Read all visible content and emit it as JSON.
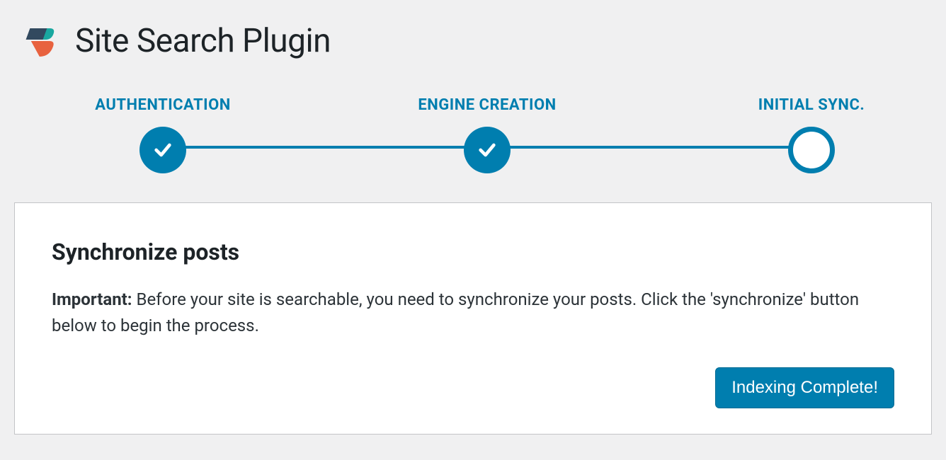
{
  "header": {
    "title": "Site Search Plugin"
  },
  "stepper": {
    "steps": [
      {
        "label": "AUTHENTICATION",
        "state": "done"
      },
      {
        "label": "ENGINE CREATION",
        "state": "done"
      },
      {
        "label": "INITIAL SYNC.",
        "state": "current"
      }
    ]
  },
  "card": {
    "title": "Synchronize posts",
    "important_label": "Important:",
    "body": "Before your site is searchable, you need to synchronize your posts. Click the 'synchronize' button below to begin the process.",
    "button_label": "Indexing Complete!"
  }
}
